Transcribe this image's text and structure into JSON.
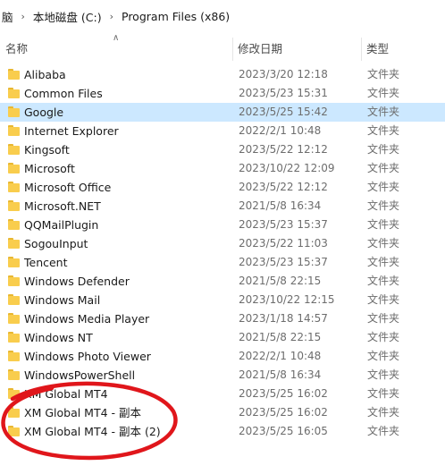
{
  "breadcrumb": {
    "items": [
      "脑",
      "本地磁盘 (C:)",
      "Program Files (x86)"
    ]
  },
  "columns": {
    "name": "名称",
    "date": "修改日期",
    "type": "类型"
  },
  "files": [
    {
      "name": "Alibaba",
      "date": "2023/3/20 12:18",
      "type": "文件夹"
    },
    {
      "name": "Common Files",
      "date": "2023/5/23 15:31",
      "type": "文件夹"
    },
    {
      "name": "Google",
      "date": "2023/5/25 15:42",
      "type": "文件夹"
    },
    {
      "name": "Internet Explorer",
      "date": "2022/2/1 10:48",
      "type": "文件夹"
    },
    {
      "name": "Kingsoft",
      "date": "2023/5/22 12:12",
      "type": "文件夹"
    },
    {
      "name": "Microsoft",
      "date": "2023/10/22 12:09",
      "type": "文件夹"
    },
    {
      "name": "Microsoft Office",
      "date": "2023/5/22 12:12",
      "type": "文件夹"
    },
    {
      "name": "Microsoft.NET",
      "date": "2021/5/8 16:34",
      "type": "文件夹"
    },
    {
      "name": "QQMailPlugin",
      "date": "2023/5/23 15:37",
      "type": "文件夹"
    },
    {
      "name": "SogouInput",
      "date": "2023/5/22 11:03",
      "type": "文件夹"
    },
    {
      "name": "Tencent",
      "date": "2023/5/23 15:37",
      "type": "文件夹"
    },
    {
      "name": "Windows Defender",
      "date": "2021/5/8 22:15",
      "type": "文件夹"
    },
    {
      "name": "Windows Mail",
      "date": "2023/10/22 12:15",
      "type": "文件夹"
    },
    {
      "name": "Windows Media Player",
      "date": "2023/1/18 14:57",
      "type": "文件夹"
    },
    {
      "name": "Windows NT",
      "date": "2021/5/8 22:15",
      "type": "文件夹"
    },
    {
      "name": "Windows Photo Viewer",
      "date": "2022/2/1 10:48",
      "type": "文件夹"
    },
    {
      "name": "WindowsPowerShell",
      "date": "2021/5/8 16:34",
      "type": "文件夹"
    },
    {
      "name": "XM Global MT4",
      "date": "2023/5/25 16:02",
      "type": "文件夹"
    },
    {
      "name": "XM Global MT4 - 副本",
      "date": "2023/5/25 16:02",
      "type": "文件夹"
    },
    {
      "name": "XM Global MT4 - 副本 (2)",
      "date": "2023/5/25 16:05",
      "type": "文件夹"
    }
  ],
  "selected_row": "Google",
  "colors": {
    "selection": "#cce8ff",
    "folder": "#f9cd4d",
    "annotation_circle": "#e0161b"
  }
}
